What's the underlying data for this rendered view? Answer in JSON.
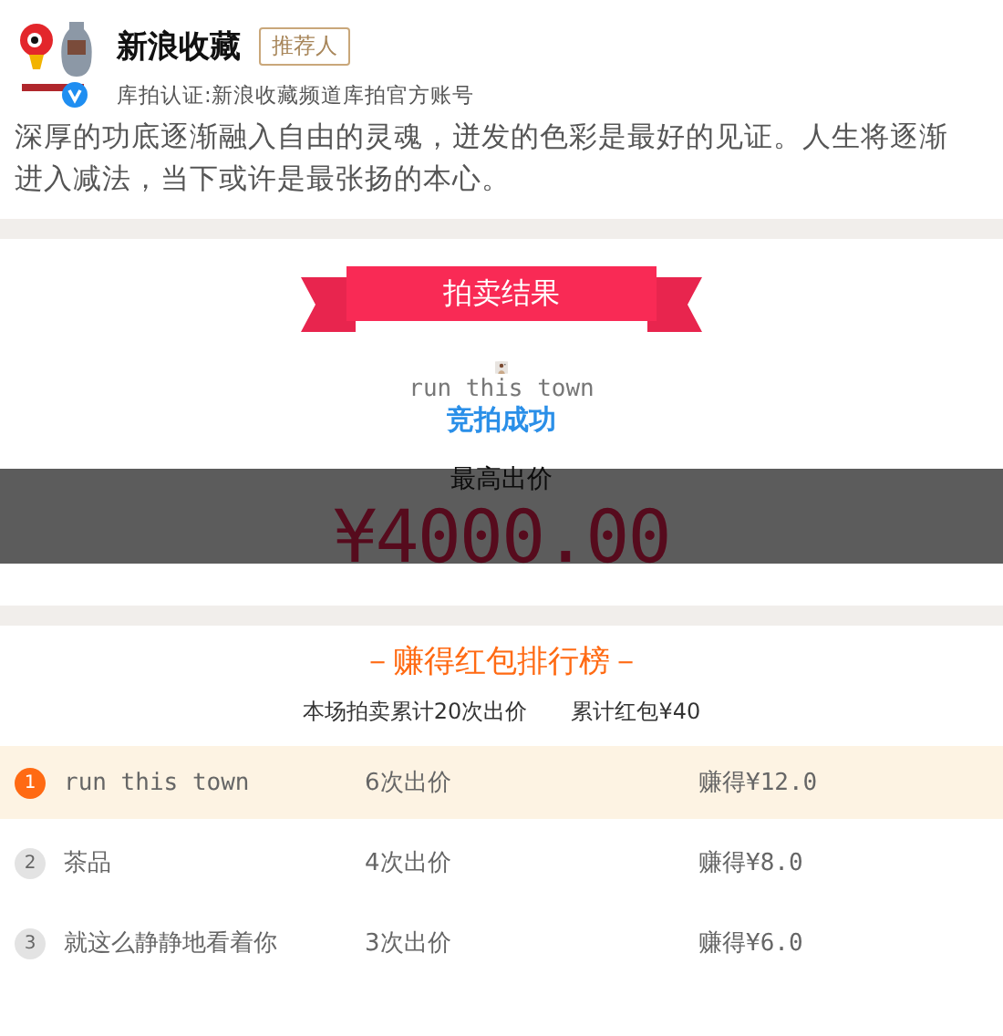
{
  "account": {
    "name": "新浪收藏",
    "badge": "推荐人",
    "verified": true,
    "certification": "库拍认证:新浪收藏频道库拍官方账号",
    "motto": "深厚的功底逐渐融入自由的灵魂，迸发的色彩是最好的见证。人生将逐渐进入减法，当下或许是最张扬的本心。"
  },
  "result": {
    "ribbon": "拍卖结果",
    "winner": "run this town",
    "status": "竞拍成功",
    "price_label": "最高出价",
    "price": "¥4000.00",
    "overlay": true
  },
  "ranking": {
    "title": "－赚得红包排行榜－",
    "total_bids": "本场拍卖累计20次出价",
    "total_bonus": "累计红包¥40",
    "rows": [
      {
        "rank": "1",
        "name": "run this town",
        "bids": "6次出价",
        "earned": "赚得¥12.0",
        "highlighted": true
      },
      {
        "rank": "2",
        "name": "茶品",
        "bids": "4次出价",
        "earned": "赚得¥8.0",
        "highlighted": false
      },
      {
        "rank": "3",
        "name": "就这么静静地看着你",
        "bids": "3次出价",
        "earned": "赚得¥6.0",
        "highlighted": false
      }
    ]
  }
}
